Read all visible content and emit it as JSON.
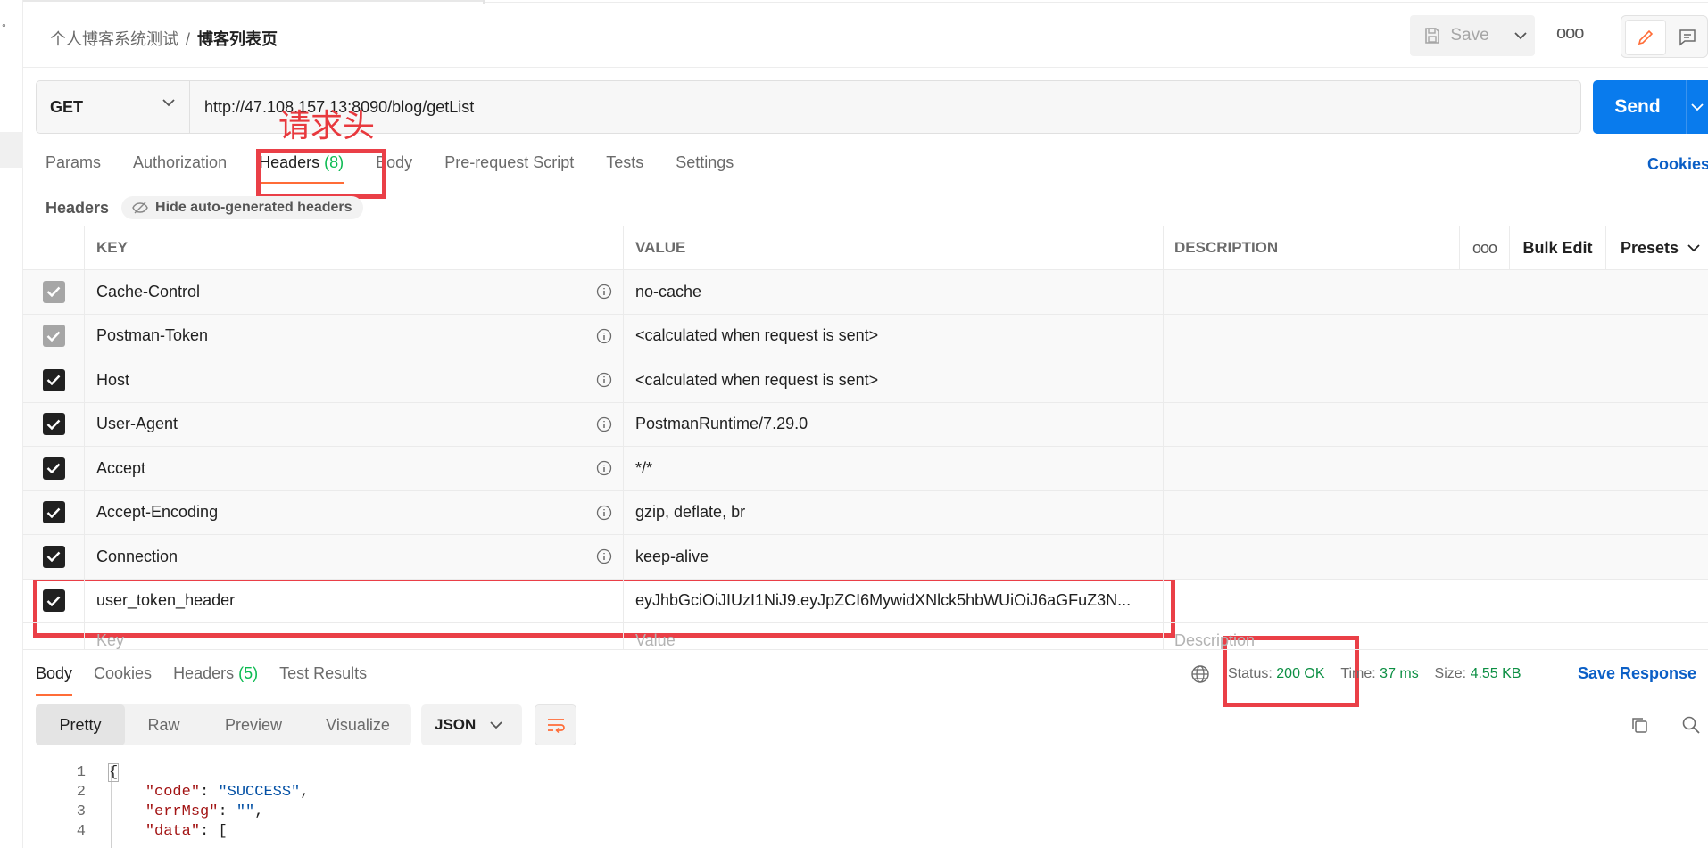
{
  "breadcrumb": {
    "parent": "个人博客系统测试",
    "separator": "/",
    "current": "博客列表页"
  },
  "header": {
    "save_label": "Save",
    "more_label": "ooo"
  },
  "request": {
    "method": "GET",
    "url": "http://47.108.157.13:8090/blog/getList",
    "send_label": "Send"
  },
  "annotation": {
    "label": "请求头"
  },
  "tabs": {
    "items": [
      {
        "label": "Params"
      },
      {
        "label": "Authorization"
      },
      {
        "label": "Headers",
        "count": "(8)"
      },
      {
        "label": "Body"
      },
      {
        "label": "Pre-request Script"
      },
      {
        "label": "Tests"
      },
      {
        "label": "Settings"
      }
    ],
    "cookies_label": "Cookies"
  },
  "headers_bar": {
    "title": "Headers",
    "hide_auto_label": "Hide auto-generated headers"
  },
  "table": {
    "columns": {
      "key": "KEY",
      "value": "VALUE",
      "description": "DESCRIPTION"
    },
    "more_label": "ooo",
    "bulk_edit_label": "Bulk Edit",
    "presets_label": "Presets",
    "rows": [
      {
        "key": "Cache-Control",
        "value": "no-cache"
      },
      {
        "key": "Postman-Token",
        "value": "<calculated when request is sent>"
      },
      {
        "key": "Host",
        "value": "<calculated when request is sent>"
      },
      {
        "key": "User-Agent",
        "value": "PostmanRuntime/7.29.0"
      },
      {
        "key": "Accept",
        "value": "*/*"
      },
      {
        "key": "Accept-Encoding",
        "value": "gzip, deflate, br"
      },
      {
        "key": "Connection",
        "value": "keep-alive"
      },
      {
        "key": "user_token_header",
        "value": "eyJhbGciOiJIUzI1NiJ9.eyJpZCI6MywidXNlck5hbWUiOiJ6aGFuZ3N..."
      }
    ],
    "placeholders": {
      "key": "Key",
      "value": "Value",
      "description": "Description"
    }
  },
  "response": {
    "tabs": [
      {
        "label": "Body"
      },
      {
        "label": "Cookies"
      },
      {
        "label": "Headers",
        "count": "(5)"
      },
      {
        "label": "Test Results"
      }
    ],
    "status_label": "Status:",
    "status_value": "200 OK",
    "time_label": "Time:",
    "time_value": "37 ms",
    "size_label": "Size:",
    "size_value": "4.55 KB",
    "save_response_label": "Save Response",
    "formats": [
      "Pretty",
      "Raw",
      "Preview",
      "Visualize"
    ],
    "content_type": "JSON",
    "code_lines": [
      {
        "n": "1",
        "text": "{"
      },
      {
        "n": "2",
        "key": "\"code\"",
        "sep": ": ",
        "val": "\"SUCCESS\"",
        "end": ","
      },
      {
        "n": "3",
        "key": "\"errMsg\"",
        "sep": ": ",
        "val": "\"\"",
        "end": ","
      },
      {
        "n": "4",
        "key": "\"data\"",
        "sep": ": ",
        "end": "["
      }
    ]
  },
  "colors": {
    "accent": "#ff6c37",
    "send": "#097bed",
    "annotation": "#ea3f47",
    "success": "#0cbb52"
  }
}
